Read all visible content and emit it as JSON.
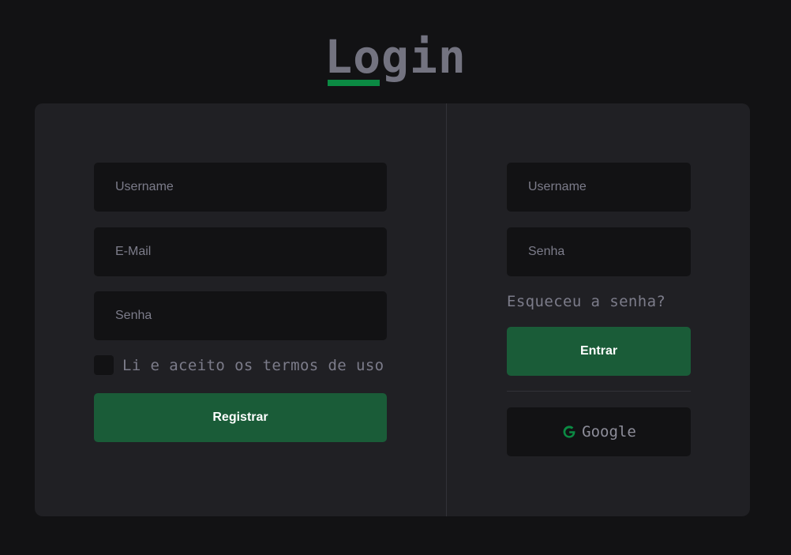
{
  "title": "Login",
  "register": {
    "username_placeholder": "Username",
    "email_placeholder": "E-Mail",
    "password_placeholder": "Senha",
    "terms_label": "Li e aceito os termos de uso",
    "submit_label": "Registrar"
  },
  "login": {
    "username_placeholder": "Username",
    "password_placeholder": "Senha",
    "forgot_label": "Esqueceu a senha?",
    "submit_label": "Entrar",
    "google_label": "Google",
    "google_icon": "google-g-icon"
  },
  "colors": {
    "background": "#121214",
    "card": "#202024",
    "accent": "#0b8a43",
    "button": "#1a5c38",
    "muted_text": "#7c7c8a"
  }
}
